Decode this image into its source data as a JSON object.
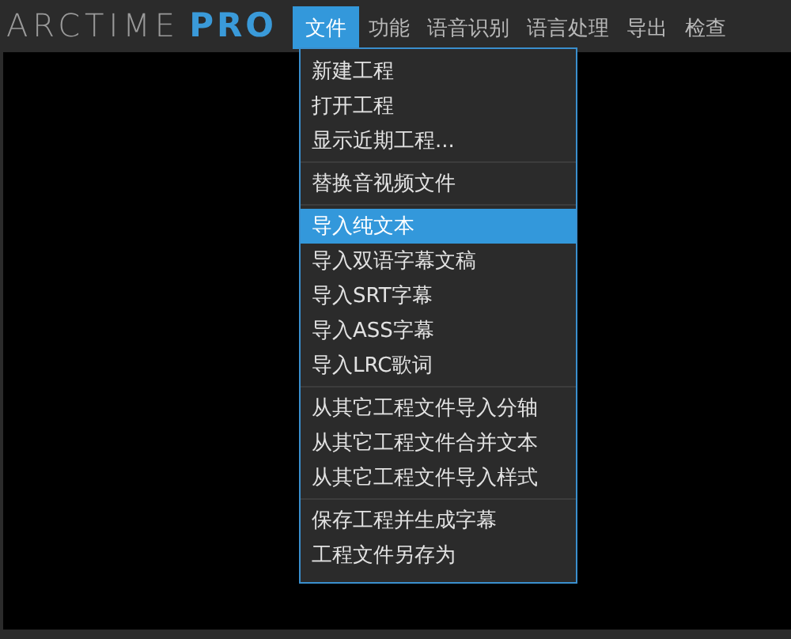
{
  "logo": {
    "name": "ARCTIME",
    "edition": "PRO"
  },
  "menu_bar": [
    {
      "label": "文件",
      "selected": true
    },
    {
      "label": "功能",
      "selected": false
    },
    {
      "label": "语音识别",
      "selected": false
    },
    {
      "label": "语言处理",
      "selected": false
    },
    {
      "label": "导出",
      "selected": false
    },
    {
      "label": "检查",
      "selected": false
    }
  ],
  "dropdown": {
    "groups": [
      [
        {
          "label": "新建工程",
          "selected": false
        },
        {
          "label": "打开工程",
          "selected": false
        },
        {
          "label": "显示近期工程...",
          "selected": false
        }
      ],
      [
        {
          "label": "替换音视频文件",
          "selected": false
        }
      ],
      [
        {
          "label": "导入纯文本",
          "selected": true
        },
        {
          "label": "导入双语字幕文稿",
          "selected": false
        },
        {
          "label": "导入SRT字幕",
          "selected": false
        },
        {
          "label": "导入ASS字幕",
          "selected": false
        },
        {
          "label": "导入LRC歌词",
          "selected": false
        }
      ],
      [
        {
          "label": "从其它工程文件导入分轴",
          "selected": false
        },
        {
          "label": "从其它工程文件合并文本",
          "selected": false
        },
        {
          "label": "从其它工程文件导入样式",
          "selected": false
        }
      ],
      [
        {
          "label": "保存工程并生成字幕",
          "selected": false
        },
        {
          "label": "工程文件另存为",
          "selected": false
        }
      ]
    ]
  }
}
